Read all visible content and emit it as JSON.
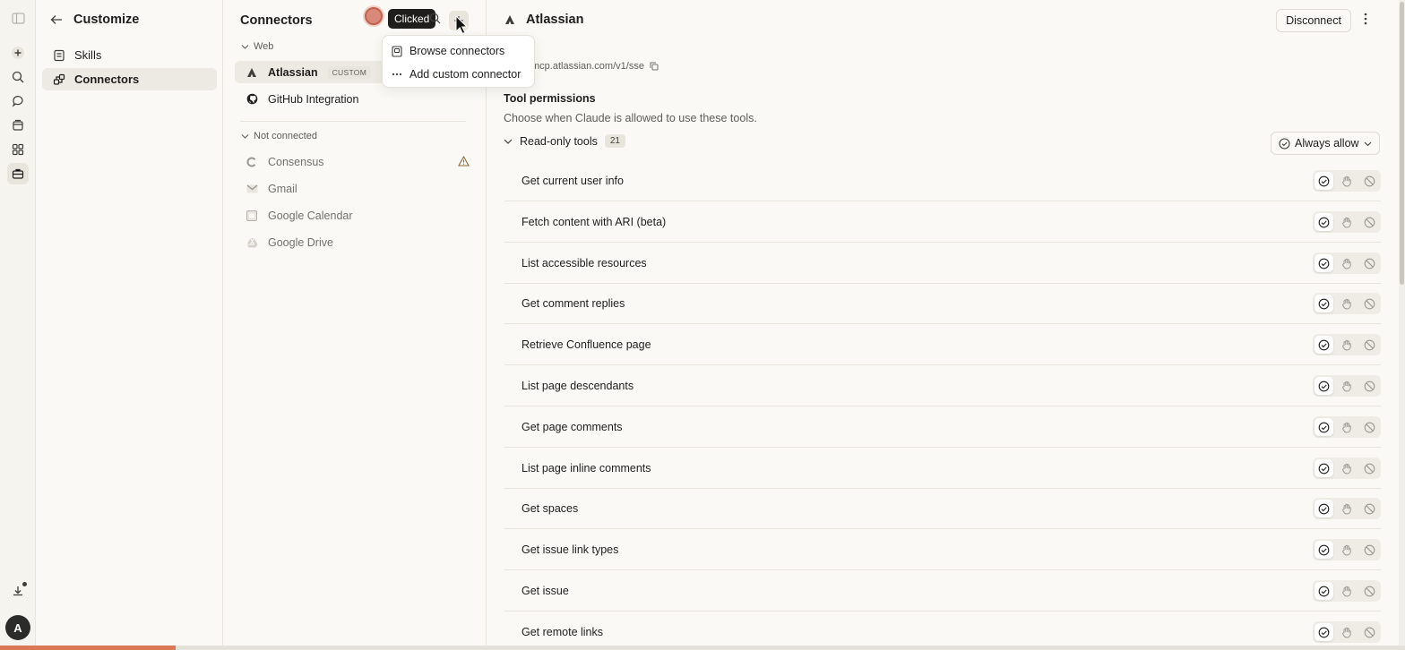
{
  "rail": {
    "icons": [
      "sidebar-toggle-icon",
      "new-chat-icon",
      "search-icon",
      "chats-icon",
      "projects-icon",
      "artifacts-icon",
      "customize-icon",
      "download-icon"
    ],
    "avatar_initial": "A"
  },
  "customize": {
    "back_icon": "arrow-left-icon",
    "title": "Customize",
    "items": [
      {
        "label": "Skills",
        "icon": "skills-icon",
        "active": false
      },
      {
        "label": "Connectors",
        "icon": "connectors-icon",
        "active": true
      }
    ]
  },
  "connectors": {
    "title": "Connectors",
    "clicked_tooltip": "Clicked",
    "sections": [
      {
        "label": "Web",
        "items": [
          {
            "name": "Atlassian",
            "badge": "CUSTOM",
            "icon": "atlassian-icon",
            "active": true
          },
          {
            "name": "GitHub Integration",
            "icon": "github-icon",
            "active": false
          }
        ]
      },
      {
        "label": "Not connected",
        "items": [
          {
            "name": "Consensus",
            "icon": "consensus-icon",
            "warning": true
          },
          {
            "name": "Gmail",
            "icon": "gmail-icon"
          },
          {
            "name": "Google Calendar",
            "icon": "google-calendar-icon"
          },
          {
            "name": "Google Drive",
            "icon": "google-drive-icon"
          }
        ]
      }
    ],
    "menu": [
      {
        "label": "Browse connectors",
        "icon": "browse-icon"
      },
      {
        "label": "Add custom connector",
        "icon": "more-icon"
      }
    ]
  },
  "detail": {
    "title": "Atlassian",
    "disconnect_label": "Disconnect",
    "url": "mcp.atlassian.com/v1/sse",
    "permissions_title": "Tool permissions",
    "permissions_subtitle": "Choose when Claude is allowed to use these tools.",
    "group_label": "Read-only tools",
    "group_count": "21",
    "group_policy": "Always allow",
    "tools": [
      "Get current user info",
      "Fetch content with ARI (beta)",
      "List accessible resources",
      "Get comment replies",
      "Retrieve Confluence page",
      "List page descendants",
      "Get page comments",
      "List page inline comments",
      "Get spaces",
      "Get issue link types",
      "Get issue",
      "Get remote links"
    ]
  },
  "colors": {
    "accent": "#d97757",
    "background": "#faf9f5",
    "border": "#e8e6dc"
  },
  "progress": 0.125
}
